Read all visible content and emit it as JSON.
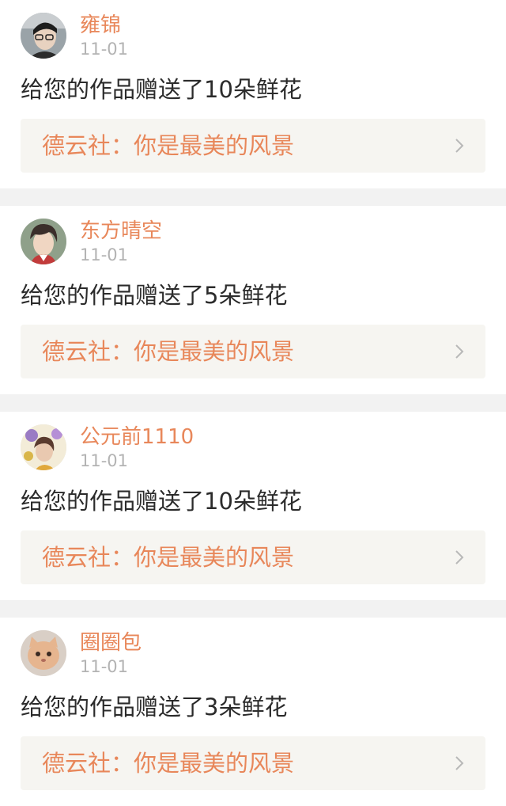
{
  "notifications": [
    {
      "username": "雍锦",
      "date": "11-01",
      "message": "给您的作品赠送了10朵鲜花",
      "work_title": "德云社：你是最美的风景",
      "avatar_icon": "avatar-man-glasses-icon"
    },
    {
      "username": "东方晴空",
      "date": "11-01",
      "message": "给您的作品赠送了5朵鲜花",
      "work_title": "德云社：你是最美的风景",
      "avatar_icon": "avatar-anime-boy-icon"
    },
    {
      "username": "公元前1110",
      "date": "11-01",
      "message": "给您的作品赠送了10朵鲜花",
      "work_title": "德云社：你是最美的风景",
      "avatar_icon": "avatar-illustration-flowers-icon"
    },
    {
      "username": "圈圈包",
      "date": "11-01",
      "message": "给您的作品赠送了3朵鲜花",
      "work_title": "德云社：你是最美的风景",
      "avatar_icon": "avatar-kitten-icon"
    }
  ],
  "colors": {
    "accent": "#e8875a",
    "date": "#b3b3b3",
    "text": "#2b2b2b",
    "link_background": "#f6f5f1",
    "separator": "#f2f2f2"
  }
}
